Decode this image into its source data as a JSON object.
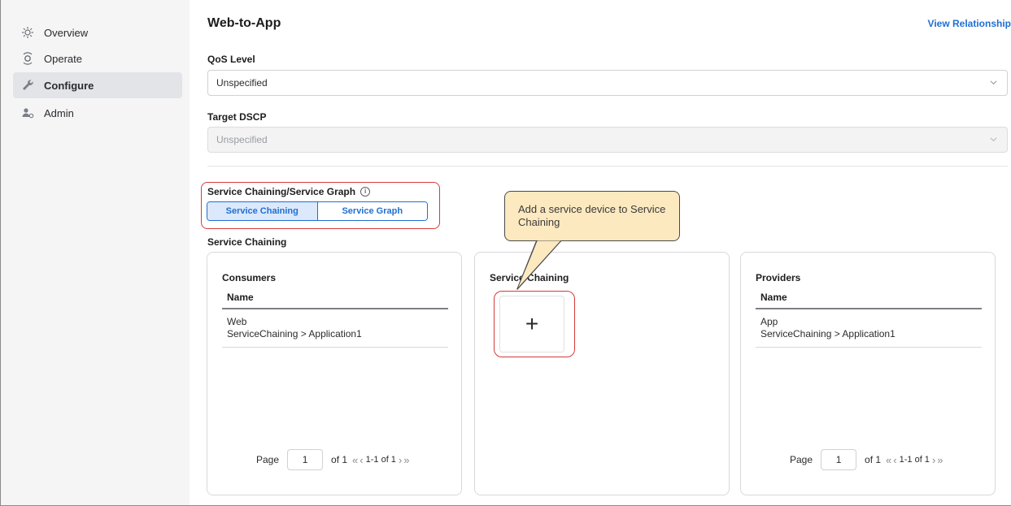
{
  "sidebar": {
    "items": [
      {
        "label": "Overview",
        "icon": "overview-icon"
      },
      {
        "label": "Operate",
        "icon": "operate-icon"
      },
      {
        "label": "Configure",
        "icon": "wrench-icon",
        "active": true
      },
      {
        "label": "Admin",
        "icon": "admin-icon"
      }
    ]
  },
  "header": {
    "title": "Web-to-App",
    "view_relationship": "View Relationship"
  },
  "qos": {
    "label": "QoS Level",
    "value": "Unspecified"
  },
  "dscp": {
    "label": "Target DSCP",
    "value": "Unspecified"
  },
  "service_chaining": {
    "label": "Service Chaining/Service Graph",
    "options": [
      "Service Chaining",
      "Service Graph"
    ],
    "selected": "Service Chaining",
    "section_label": "Service Chaining"
  },
  "callout": {
    "text": "Add a service device to Service Chaining"
  },
  "consumers": {
    "title": "Consumers",
    "column": "Name",
    "rows": [
      {
        "name": "Web",
        "path": "ServiceChaining > Application1"
      }
    ],
    "pager": {
      "page_label": "Page",
      "page": "1",
      "of": "of 1",
      "range": "1-1 of 1"
    }
  },
  "chaining_card": {
    "title": "Service Chaining",
    "add_symbol": "+"
  },
  "providers": {
    "title": "Providers",
    "column": "Name",
    "rows": [
      {
        "name": "App",
        "path": "ServiceChaining > Application1"
      }
    ],
    "pager": {
      "page_label": "Page",
      "page": "1",
      "of": "of 1",
      "range": "1-1 of 1"
    }
  },
  "colors": {
    "accent": "#1f6fd1",
    "highlight": "#d63a3a",
    "callout_bg": "#fde9c0"
  }
}
